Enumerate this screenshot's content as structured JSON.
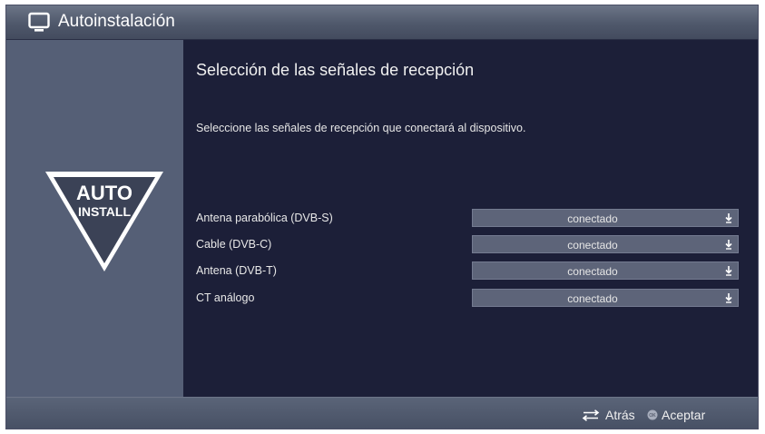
{
  "window": {
    "title": "Autoinstalación"
  },
  "logo": {
    "line1": "AUTO",
    "line2": "INSTALL"
  },
  "main": {
    "heading": "Selección de las señales de recepción",
    "description": "Seleccione las señales de recepción que conectará al dispositivo.",
    "rows": [
      {
        "label": "Antena parabólica (DVB-S)",
        "value": "conectado"
      },
      {
        "label": "Cable (DVB-C)",
        "value": "conectado"
      },
      {
        "label": "Antena (DVB-T)",
        "value": "conectado"
      },
      {
        "label": "CT análogo",
        "value": "conectado"
      }
    ]
  },
  "footer": {
    "back_label": "Atrás",
    "accept_label": "Aceptar"
  },
  "icons": {
    "title": "tv-icon",
    "dropdown": "chevron-down-icon",
    "back": "swap-arrows-icon",
    "ok": "ok-button-icon"
  },
  "colors": {
    "background": "#1c1f38",
    "side_panel": "#555f76",
    "select": "#5d6479",
    "title_bar": "#4f586b"
  }
}
